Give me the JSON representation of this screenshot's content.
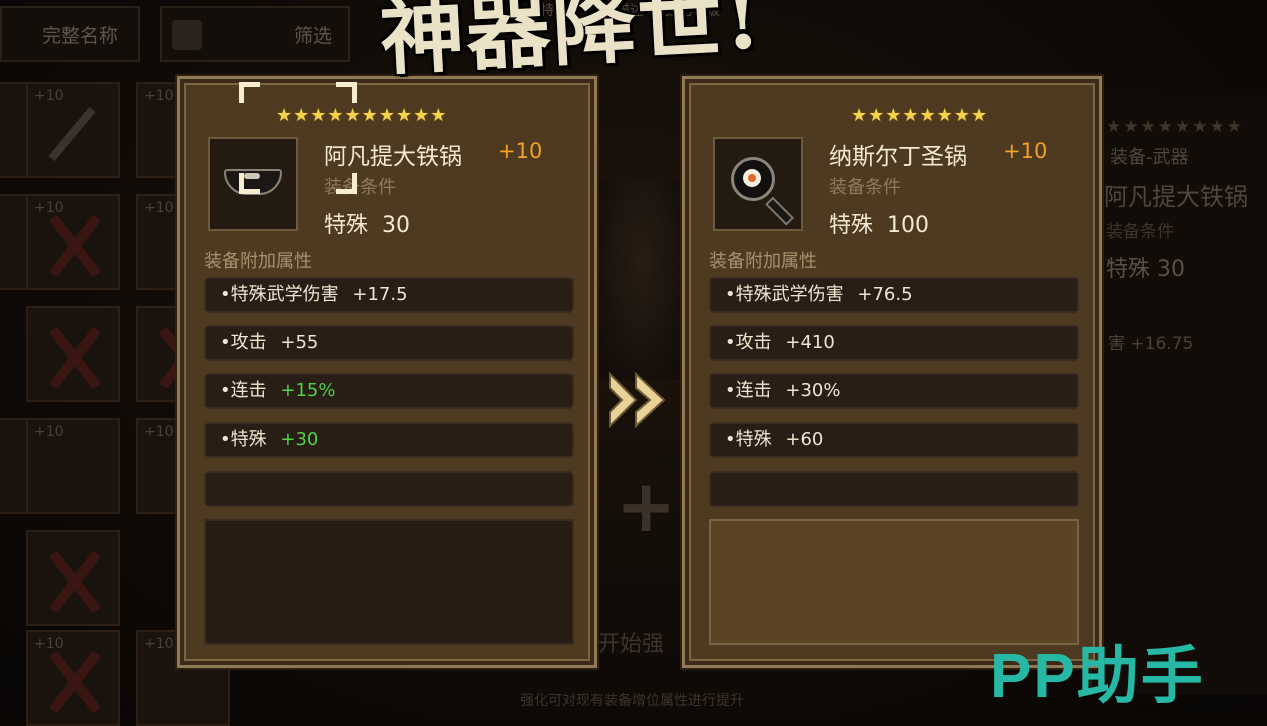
{
  "top_bar": {
    "sort_label": "完整名称",
    "filter_label": "筛选",
    "faint_tabs": [
      "特性",
      "特性描述",
      "强化等级"
    ]
  },
  "inventory": {
    "levels": [
      "+10",
      "+10",
      "+10",
      "+10",
      "+10",
      "+10",
      "+10",
      "+10"
    ]
  },
  "banner_text": "神器降世!",
  "left_card": {
    "stars": "★★★★★★★★★★",
    "item_name": "阿凡提大铁锅",
    "item_plus": "+10",
    "requirement_label": "装备条件",
    "main_stat_label": "特殊",
    "main_stat_value": "30",
    "section_label": "装备附加属性",
    "attributes": [
      {
        "label": "•特殊武学伤害",
        "value": "+17.5",
        "color": "#efe5cf"
      },
      {
        "label": "•攻击",
        "value": "+55",
        "color": "#efe5cf"
      },
      {
        "label": "•连击",
        "value": "+15%",
        "color": "#4fd14a"
      },
      {
        "label": "•特殊",
        "value": "+30",
        "color": "#4fd14a"
      }
    ]
  },
  "right_card": {
    "stars": "★★★★★★★★",
    "item_name": "纳斯尔丁圣锅",
    "item_plus": "+10",
    "requirement_label": "装备条件",
    "main_stat_label": "特殊",
    "main_stat_value": "100",
    "section_label": "装备附加属性",
    "attributes": [
      {
        "label": "•特殊武学伤害",
        "value": "+76.5",
        "color": "#efe5cf"
      },
      {
        "label": "•攻击",
        "value": "+410",
        "color": "#efe5cf"
      },
      {
        "label": "•连击",
        "value": "+30%",
        "color": "#efe5cf"
      },
      {
        "label": "•特殊",
        "value": "+60",
        "color": "#efe5cf"
      }
    ]
  },
  "background_card": {
    "stars": "★★★★★★★★",
    "category": "装备-武器",
    "item_name": "阿凡提大铁锅",
    "requirement_label": "装备条件",
    "main_stat": "特殊  30",
    "attr_text": "害  +16.75"
  },
  "center": {
    "start_button": "开始强",
    "hint": "强化可对现有装备增位属性进行提升"
  },
  "watermark": "PP助手",
  "colors": {
    "accent_orange": "#f0a12b",
    "star_gold": "#f3d34a",
    "bonus_green": "#4fd14a",
    "card_brown": "#584125"
  }
}
